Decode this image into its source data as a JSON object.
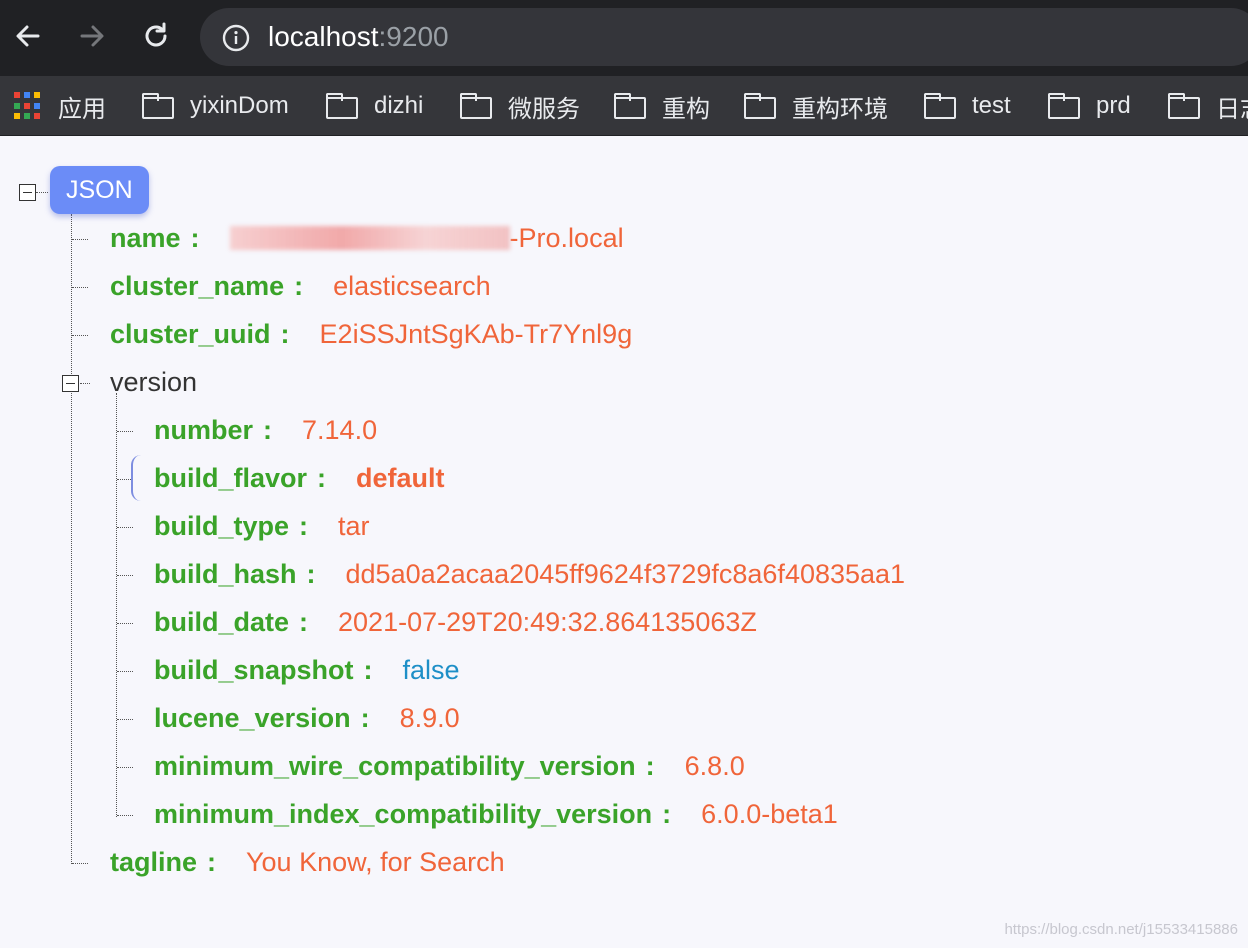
{
  "browser": {
    "url_host": "localhost",
    "url_port": ":9200",
    "bookmarks": [
      "应用",
      "yixinDom",
      "dizhi",
      "微服务",
      "重构",
      "重构环境",
      "test",
      "prd",
      "日志"
    ]
  },
  "json": {
    "root_label": "JSON",
    "name": {
      "key": "name",
      "value_visible": "-Pro.local"
    },
    "cluster_name": {
      "key": "cluster_name",
      "value": "elasticsearch"
    },
    "cluster_uuid": {
      "key": "cluster_uuid",
      "value": "E2iSSJntSgKAb-Tr7Ynl9g"
    },
    "version": {
      "label": "version",
      "number": {
        "key": "number",
        "value": "7.14.0"
      },
      "build_flavor": {
        "key": "build_flavor",
        "value": "default"
      },
      "build_type": {
        "key": "build_type",
        "value": "tar"
      },
      "build_hash": {
        "key": "build_hash",
        "value": "dd5a0a2acaa2045ff9624f3729fc8a6f40835aa1"
      },
      "build_date": {
        "key": "build_date",
        "value": "2021-07-29T20:49:32.864135063Z"
      },
      "build_snapshot": {
        "key": "build_snapshot",
        "value": "false"
      },
      "lucene_version": {
        "key": "lucene_version",
        "value": "8.9.0"
      },
      "minimum_wire_compatibility_version": {
        "key": "minimum_wire_compatibility_version",
        "value": "6.8.0"
      },
      "minimum_index_compatibility_version": {
        "key": "minimum_index_compatibility_version",
        "value": "6.0.0-beta1"
      }
    },
    "tagline": {
      "key": "tagline",
      "value": "You Know, for Search"
    },
    "separator": ":"
  },
  "watermark": "https://blog.csdn.net/j15533415886"
}
